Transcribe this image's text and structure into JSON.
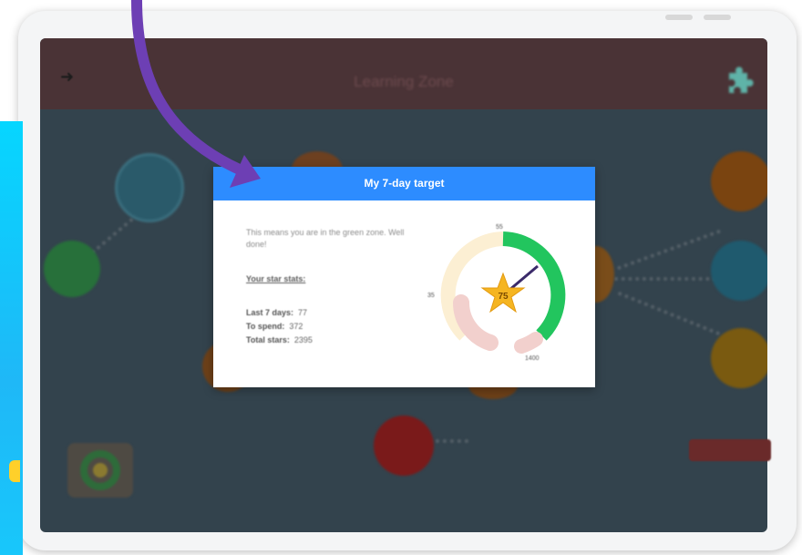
{
  "app": {
    "screen_title": "Learning Zone"
  },
  "modal": {
    "title": "My 7-day target",
    "message": "This means you are in the green zone. Well done!",
    "stats_heading": "Your star stats:",
    "stats": [
      {
        "label": "Last 7 days:",
        "value": "77"
      },
      {
        "label": "To spend:",
        "value": "372"
      },
      {
        "label": "Total stars:",
        "value": "2395"
      }
    ]
  },
  "gauge": {
    "value": "75",
    "mark_left": "35",
    "mark_top": "55",
    "mark_bottom": "1400",
    "fill_fraction": 0.75,
    "colors": {
      "green": "#22c55e",
      "cream": "#fcefd3",
      "pink": "#f4d4d0",
      "star": "#f5b521"
    }
  },
  "colors": {
    "header_blue": "#2d8cff",
    "arrow_purple": "#6d3fb4",
    "overlay": "#33434d"
  },
  "icons": [
    "back-arrow-icon",
    "puzzle-icon",
    "star-icon",
    "pointing-arrow"
  ]
}
